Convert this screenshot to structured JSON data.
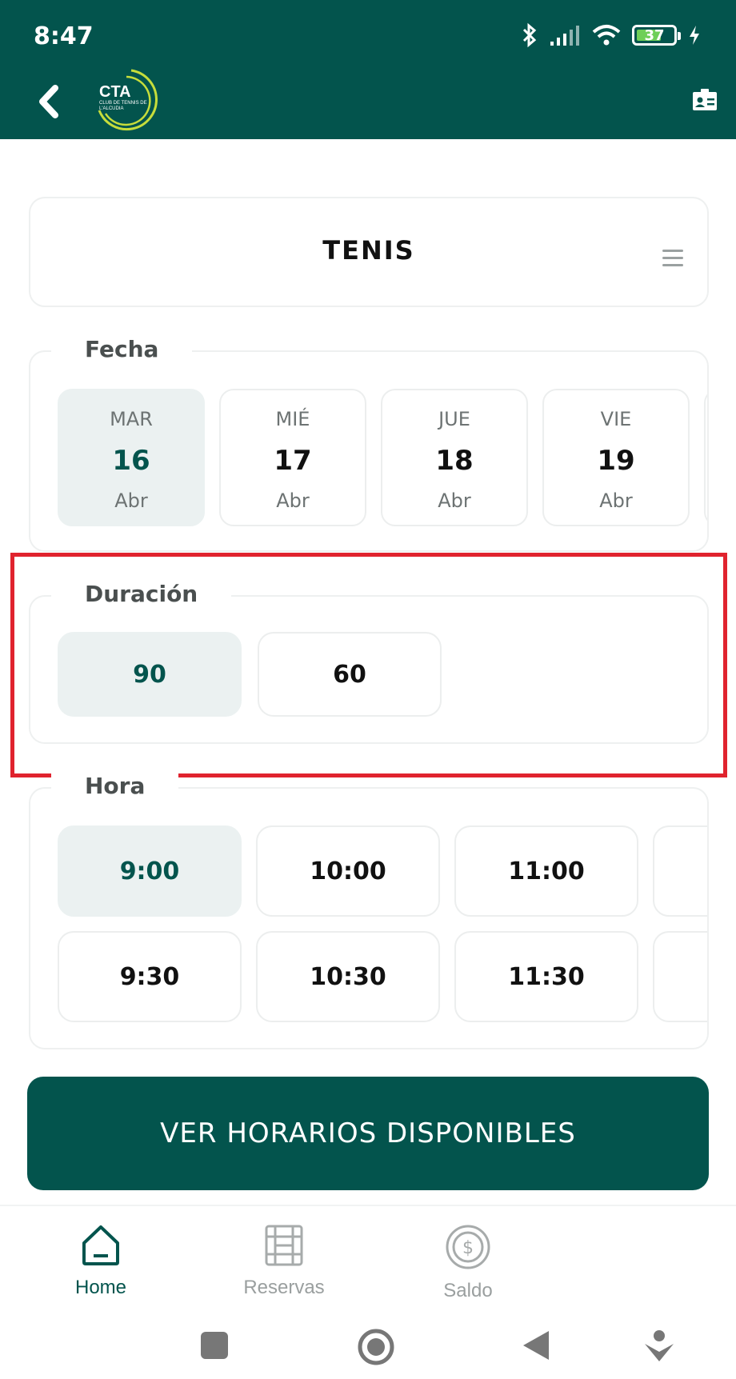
{
  "status_bar": {
    "time": "8:47",
    "battery": "37"
  },
  "header": {
    "logo_text": "CTA",
    "logo_subtext": "CLUB DE TENNIS DE L'ALCUDIA"
  },
  "sport": {
    "title": "TENIS"
  },
  "fecha": {
    "label": "Fecha",
    "dates": [
      {
        "dow": "MAR",
        "day": "16",
        "month": "Abr",
        "selected": true
      },
      {
        "dow": "MIÉ",
        "day": "17",
        "month": "Abr",
        "selected": false
      },
      {
        "dow": "JUE",
        "day": "18",
        "month": "Abr",
        "selected": false
      },
      {
        "dow": "VIE",
        "day": "19",
        "month": "Abr",
        "selected": false
      }
    ]
  },
  "duracion": {
    "label": "Duración",
    "options": [
      "90",
      "60"
    ],
    "selected": "90"
  },
  "hora": {
    "label": "Hora",
    "row1": [
      "9:00",
      "10:00",
      "11:00"
    ],
    "row2": [
      "9:30",
      "10:30",
      "11:30"
    ],
    "selected": "9:00"
  },
  "cta_label": "VER HORARIOS DISPONIBLES",
  "bottom_nav": {
    "items": [
      {
        "label": "Home",
        "icon": "home-icon",
        "active": true
      },
      {
        "label": "Reservas",
        "icon": "reservas-icon",
        "active": false
      },
      {
        "label": "Saldo",
        "icon": "saldo-icon",
        "active": false
      }
    ]
  },
  "colors": {
    "primary": "#03544d",
    "selected_bg": "#ebf1f1",
    "highlight": "#e0232e"
  }
}
